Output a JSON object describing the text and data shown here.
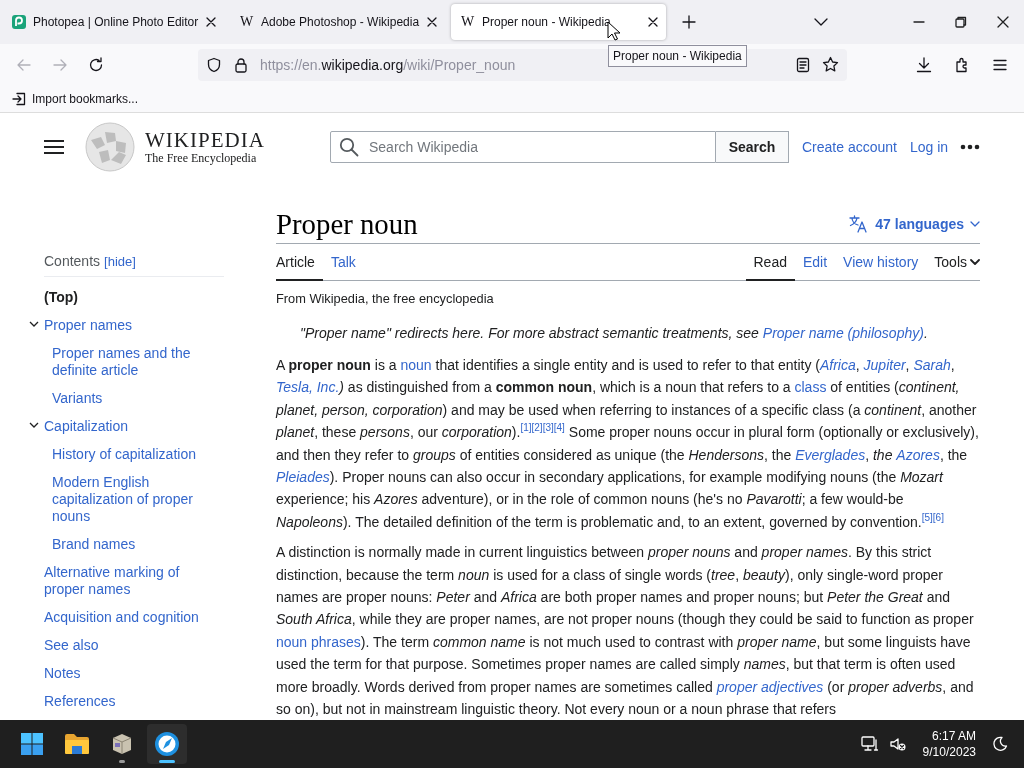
{
  "browser": {
    "tabs": [
      {
        "kind": "drawn",
        "title": "Photopea | Online Photo Editor",
        "selected": false
      },
      {
        "kind": "glyph",
        "favicon": "W",
        "title": "Adobe Photoshop - Wikipedia",
        "selected": false
      },
      {
        "kind": "glyph",
        "favicon": "W",
        "title": "Proper noun - Wikipedia",
        "selected": true
      }
    ],
    "tooltip": "Proper noun - Wikipedia",
    "url": {
      "scheme": "https://en.",
      "domain": "wikipedia.org",
      "path": "/wiki/Proper_noun"
    },
    "bookmark": "Import bookmarks..."
  },
  "wiki": {
    "wordmark": "WIKIPEDIA",
    "tagline": "The Free Encyclopedia",
    "search": {
      "placeholder": "Search Wikipedia",
      "button": "Search"
    },
    "user_links": [
      "Create account",
      "Log in"
    ]
  },
  "toc": {
    "title": "Contents",
    "toggle": "[hide]",
    "items": [
      {
        "label": "(Top)",
        "selected": true
      },
      {
        "label": "Proper names",
        "selected": false,
        "expanded": true,
        "children": [
          {
            "label": "Proper names and the definite article",
            "selected": false
          },
          {
            "label": "Variants",
            "selected": false
          }
        ]
      },
      {
        "label": "Capitalization",
        "selected": false,
        "expanded": true,
        "children": [
          {
            "label": "History of capitalization",
            "selected": false
          },
          {
            "label": "Modern English capitalization of proper nouns",
            "selected": false
          },
          {
            "label": "Brand names",
            "selected": false
          }
        ]
      },
      {
        "label": "Alternative marking of proper names",
        "selected": false
      },
      {
        "label": "Acquisition and cognition",
        "selected": false
      },
      {
        "label": "See also",
        "selected": false
      },
      {
        "label": "Notes",
        "selected": false
      },
      {
        "label": "References",
        "selected": false
      }
    ]
  },
  "article": {
    "title": "Proper noun",
    "languages": "47 languages",
    "tabs": [
      {
        "label": "Article",
        "selected": true
      },
      {
        "label": "Talk",
        "selected": false
      }
    ],
    "views": [
      {
        "label": "Read",
        "selected": true
      },
      {
        "label": "Edit",
        "selected": false
      },
      {
        "label": "View history",
        "selected": false
      }
    ],
    "tools": "Tools",
    "tagline": "From Wikipedia, the free encyclopedia",
    "hatnote": [
      {
        "kind": "text",
        "text": "\"Proper name\" redirects here. For more abstract semantic treatments, see "
      },
      {
        "kind": "link",
        "text": "Proper name (philosophy)"
      },
      {
        "kind": "text",
        "text": "."
      }
    ],
    "paragraphs": [
      [
        {
          "kind": "text",
          "text": "A **proper noun** is a "
        },
        {
          "kind": "link",
          "text": "noun"
        },
        {
          "kind": "text",
          "text": " that identifies a single entity and is used to refer to that entity ("
        },
        {
          "kind": "link",
          "text": "*Africa*"
        },
        {
          "kind": "text",
          "text": ", "
        },
        {
          "kind": "link",
          "text": "*Jupiter*"
        },
        {
          "kind": "text",
          "text": ", "
        },
        {
          "kind": "link",
          "text": "*Sarah*"
        },
        {
          "kind": "text",
          "text": ", "
        },
        {
          "kind": "link",
          "text": "*Tesla, Inc.*"
        },
        {
          "kind": "text",
          "text": "*)* as distinguished from a **common noun**, which is a noun that refers to a "
        },
        {
          "kind": "link",
          "text": "class"
        },
        {
          "kind": "text",
          "text": " of entities (*continent, planet, person, corporation*) and may be used when referring to instances of a specific class (a *continent*, another *planet*, these *persons*, our *corporation*)."
        },
        {
          "kind": "ref",
          "text": "[1]"
        },
        {
          "kind": "ref",
          "text": "[2]"
        },
        {
          "kind": "ref",
          "text": "[3]"
        },
        {
          "kind": "ref",
          "text": "[4]"
        },
        {
          "kind": "text",
          "text": " Some proper nouns occur in plural form (optionally or exclusively), and then they refer to *groups* of entities considered as unique (the *Hendersons*, the "
        },
        {
          "kind": "link",
          "text": "*Everglades*"
        },
        {
          "kind": "text",
          "text": ", *the* "
        },
        {
          "kind": "link",
          "text": "*Azores*"
        },
        {
          "kind": "text",
          "text": ", the "
        },
        {
          "kind": "link",
          "text": "*Pleiades*"
        },
        {
          "kind": "text",
          "text": "). Proper nouns can also occur in secondary applications, for example modifying nouns (the *Mozart* experience; his *Azores* adventure), or in the role of common nouns (he's no *Pavarotti*; a few would-be *Napoleons*). The detailed definition of the term is problematic and, to an extent, governed by convention."
        },
        {
          "kind": "ref",
          "text": "[5]"
        },
        {
          "kind": "ref",
          "text": "[6]"
        }
      ],
      [
        {
          "kind": "text",
          "text": "A distinction is normally made in current linguistics between *proper nouns* and *proper names*. By this strict distinction, because the term *noun* is used for a class of single words (*tree*, *beauty*), only single-word proper names are proper nouns: *Peter* and *Africa* are both proper names and proper nouns; but *Peter the Great* and *South Africa*, while they are proper names, are not proper nouns (though they could be said to function as proper "
        },
        {
          "kind": "link",
          "text": "noun phrases"
        },
        {
          "kind": "text",
          "text": "). The term *common name* is not much used to contrast with *proper name*, but some linguists have used the term for that purpose. Sometimes proper names are called simply *names*, but that term is often used more broadly. Words derived from proper names are sometimes called "
        },
        {
          "kind": "link",
          "text": "*proper adjectives*"
        },
        {
          "kind": "text",
          "text": " (or *proper adverbs*, and so on), but not in mainstream linguistic theory. Not every noun or a noun phrase that refers"
        }
      ]
    ]
  },
  "taskbar": {
    "apps": [
      {
        "kind": "start",
        "running": false,
        "selected": false
      },
      {
        "kind": "folder",
        "running": false,
        "selected": false
      },
      {
        "kind": "box",
        "running": true,
        "selected": false
      },
      {
        "kind": "browser",
        "running": true,
        "selected": true
      }
    ],
    "time": "6:17 AM",
    "date": "9/10/2023"
  }
}
